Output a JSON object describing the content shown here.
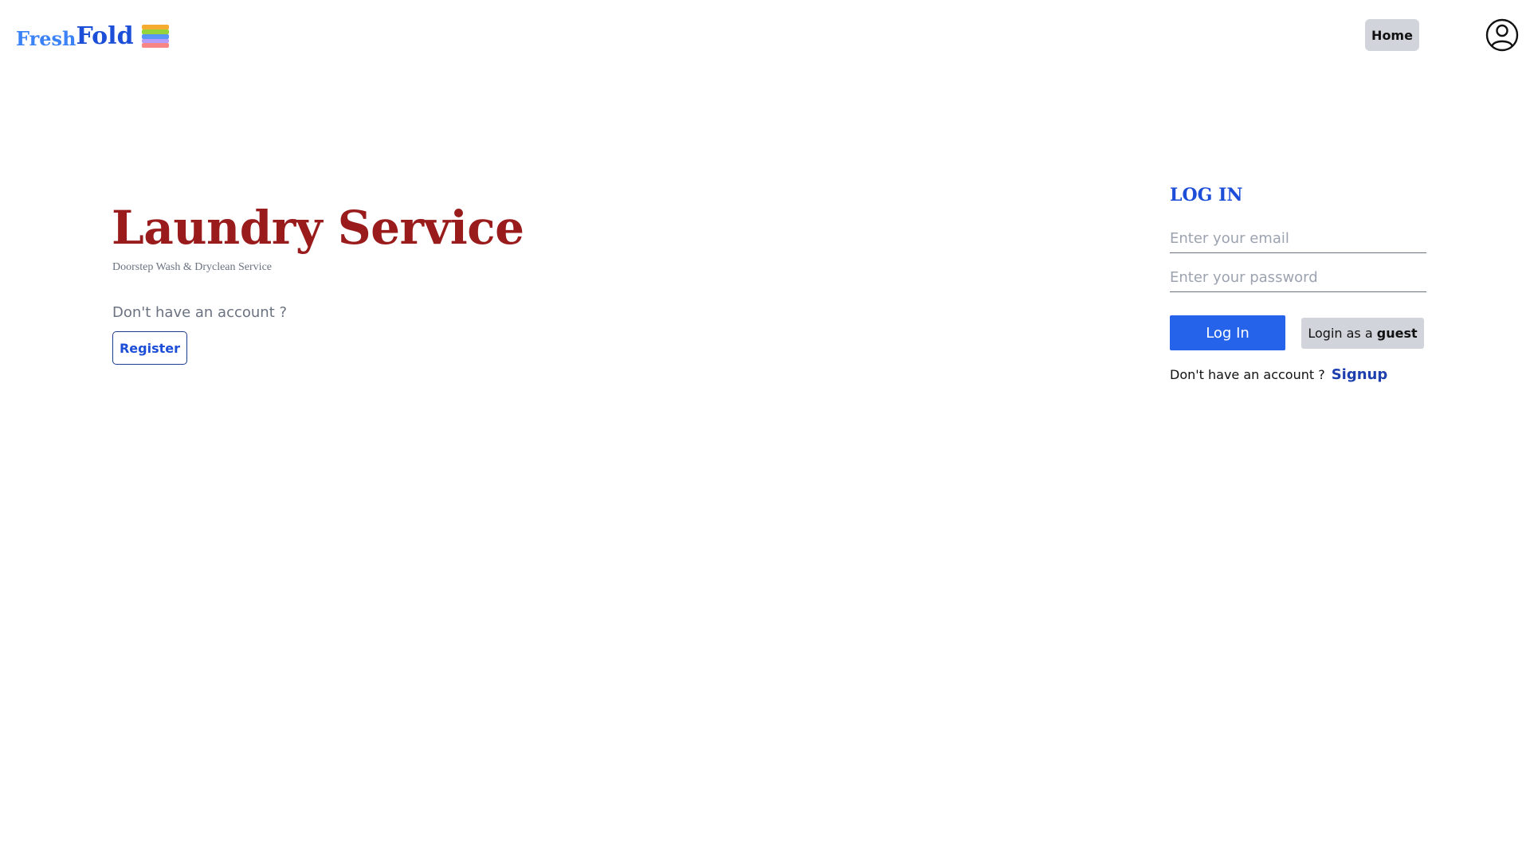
{
  "header": {
    "logo": {
      "part1": "Fresh",
      "part2": "Fold",
      "icon": "folded-clothes-stack-icon"
    },
    "nav": {
      "home_label": "Home"
    },
    "user_icon": "user-circle-icon"
  },
  "hero": {
    "title": "Laundry Service",
    "subtitle": "Doorstep Wash & Dryclean Service",
    "account_prompt": "Don't have an account ?",
    "register_label": "Register"
  },
  "login": {
    "title": "LOG IN",
    "email_placeholder": "Enter your email",
    "email_value": "",
    "password_placeholder": "Enter your password",
    "password_value": "",
    "login_label": "Log In",
    "guest_prefix": "Login as a",
    "guest_emphasis": "guest",
    "signup_prompt": "Don't have an account ?",
    "signup_label": "Signup"
  },
  "colors": {
    "brand_blue": "#1d4ed8",
    "brand_light_blue": "#3b82f6",
    "title_red": "#991b1b",
    "primary_button": "#2563eb",
    "secondary_button": "#d1d5db",
    "muted_text": "#6b7280"
  }
}
